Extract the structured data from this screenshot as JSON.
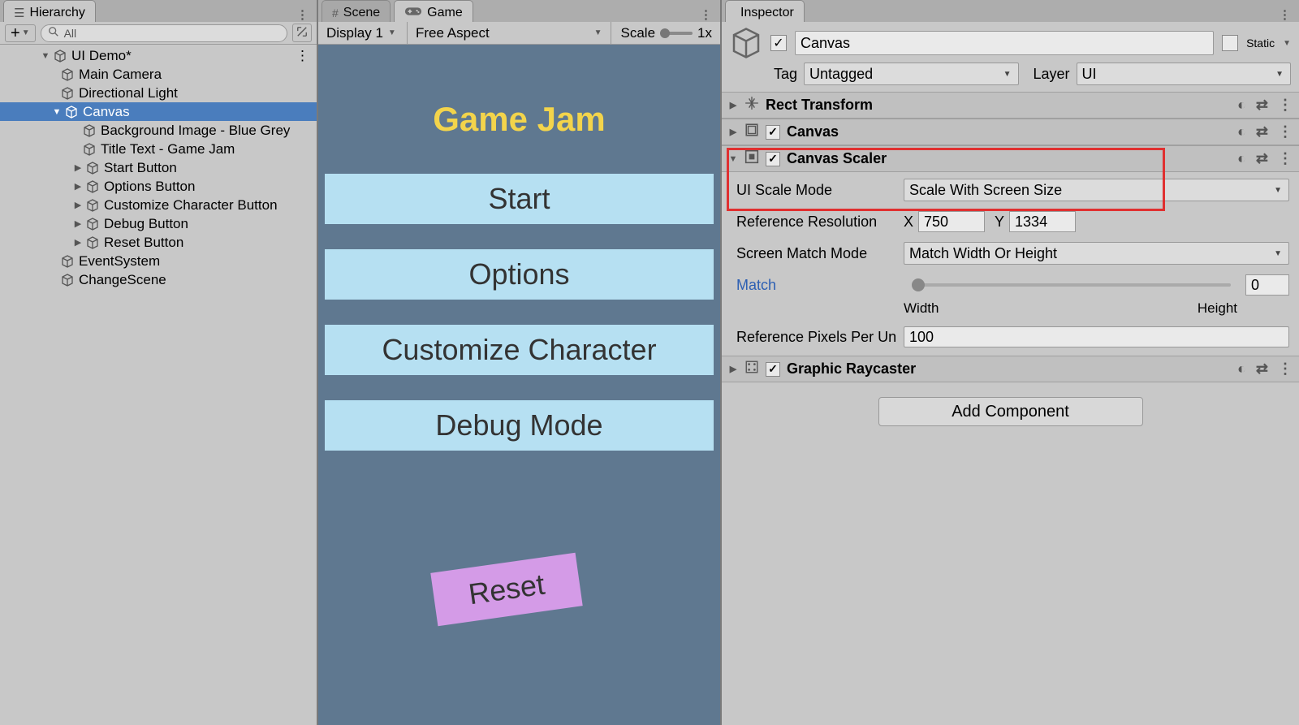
{
  "hierarchy": {
    "tab_title": "Hierarchy",
    "search_prefix": "All",
    "root": "UI Demo*",
    "items": [
      "Main Camera",
      "Directional Light",
      "Canvas",
      "Background Image - Blue Grey",
      "Title Text - Game Jam",
      "Start Button",
      "Options Button",
      "Customize Character Button",
      "Debug Button",
      "Reset Button",
      "EventSystem",
      "ChangeScene"
    ]
  },
  "center": {
    "tab_scene": "Scene",
    "tab_game": "Game",
    "display": "Display 1",
    "aspect": "Free Aspect",
    "scale_label": "Scale",
    "scale_value": "1x",
    "game_title": "Game Jam",
    "buttons": [
      "Start",
      "Options",
      "Customize Character",
      "Debug Mode"
    ],
    "reset": "Reset"
  },
  "inspector": {
    "tab": "Inspector",
    "static": "Static",
    "name": "Canvas",
    "tag_label": "Tag",
    "tag_value": "Untagged",
    "layer_label": "Layer",
    "layer_value": "UI",
    "components": {
      "rect": "Rect Transform",
      "canvas": "Canvas",
      "scaler": "Canvas Scaler",
      "raycaster": "Graphic Raycaster"
    },
    "scaler_fields": {
      "ui_mode_label": "UI Scale Mode",
      "ui_mode_value": "Scale With Screen Size",
      "ref_res_label": "Reference Resolution",
      "ref_x_label": "X",
      "ref_x": "750",
      "ref_y_label": "Y",
      "ref_y": "1334",
      "match_mode_label": "Screen Match Mode",
      "match_mode_value": "Match Width Or Height",
      "match_label": "Match",
      "match_value": "0",
      "match_width": "Width",
      "match_height": "Height",
      "rppu_label": "Reference Pixels Per Un",
      "rppu_value": "100"
    },
    "add_component": "Add Component"
  }
}
